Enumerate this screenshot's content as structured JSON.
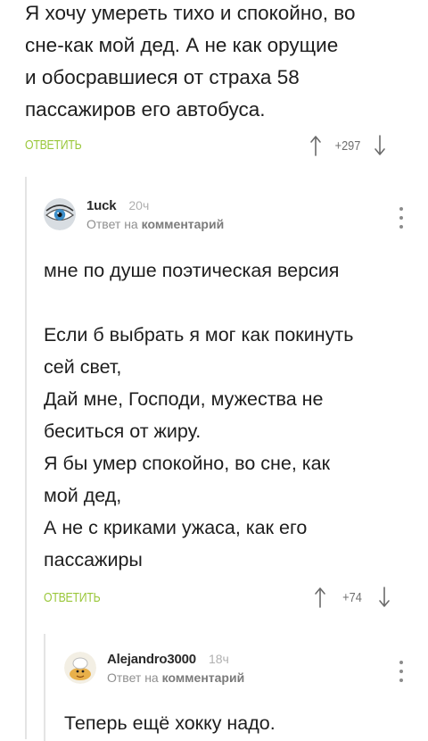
{
  "comment1": {
    "lines": [
      "Я хочу умереть тихо и спокойно, во",
      "сне-как мой дед. А не как орущие",
      "и обосравшиеся от страха 58",
      "пассажиров его автобуса."
    ],
    "reply_label": "ОТВЕТИТЬ",
    "rating": "+297"
  },
  "comment2": {
    "author": "1uck",
    "time": "20ч",
    "reply_to_prefix": "Ответ на",
    "reply_to_target": "комментарий",
    "paragraph1": "мне по душе поэтическая версия",
    "lines": [
      "Если б выбрать я мог как покинуть",
      "сей свет,",
      "Дай мне, Господи, мужества не",
      "беситься от жиру.",
      "Я бы умер спокойно, во сне, как",
      "мой дед,",
      "А не с криками ужаса, как его",
      "пассажиры"
    ],
    "reply_label": "ОТВЕТИТЬ",
    "rating": "+74"
  },
  "comment3": {
    "author": "Alejandro3000",
    "time": "18ч",
    "reply_to_prefix": "Ответ на",
    "reply_to_target": "комментарий",
    "first_line": "Теперь ещё хокку надо."
  },
  "icons": {
    "upvote": "arrow-up-icon",
    "downvote": "arrow-down-icon",
    "menu": "more-vertical-icon"
  },
  "colors": {
    "accent": "#9ac73a",
    "muted": "#8f8f8f",
    "text": "#1e1e1e"
  }
}
